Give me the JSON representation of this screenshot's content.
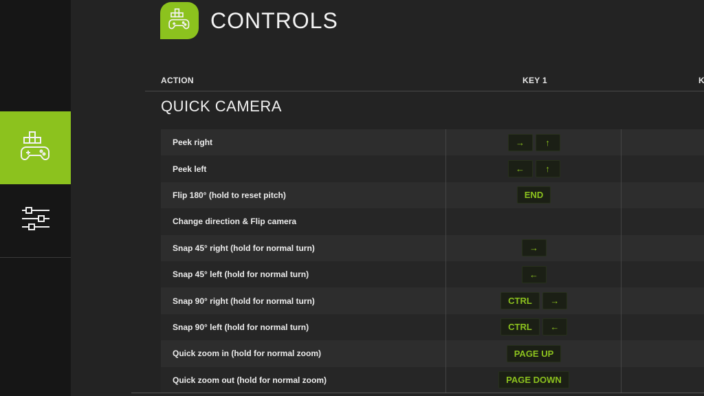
{
  "sidebar": {
    "tabs": [
      {
        "icon": "controls-icon",
        "active": true
      },
      {
        "icon": "sliders-icon",
        "active": false
      }
    ],
    "accent": "#8cc21e"
  },
  "header": {
    "title": "CONTROLS",
    "icon": "controls-icon"
  },
  "table": {
    "columns": {
      "action": "ACTION",
      "key1": "KEY 1",
      "key2": "K"
    },
    "section": "QUICK CAMERA",
    "rows": [
      {
        "label": "Peek right",
        "keys": [
          "→",
          "↑"
        ]
      },
      {
        "label": "Peek left",
        "keys": [
          "←",
          "↑"
        ]
      },
      {
        "label": "Flip 180° (hold to reset pitch)",
        "keys": [
          "END"
        ]
      },
      {
        "label": "Change direction & Flip camera",
        "keys": []
      },
      {
        "label": "Snap 45° right (hold for normal turn)",
        "keys": [
          "→"
        ]
      },
      {
        "label": "Snap 45° left (hold for normal turn)",
        "keys": [
          "←"
        ]
      },
      {
        "label": "Snap 90° right (hold for normal turn)",
        "keys": [
          "CTRL",
          "→"
        ]
      },
      {
        "label": "Snap 90° left (hold for normal turn)",
        "keys": [
          "CTRL",
          "←"
        ]
      },
      {
        "label": "Quick zoom in (hold for normal zoom)",
        "keys": [
          "PAGE UP"
        ]
      },
      {
        "label": "Quick zoom out (hold for normal zoom)",
        "keys": [
          "PAGE DOWN"
        ]
      }
    ]
  },
  "colors": {
    "accent": "#8cc21e",
    "key_bg": "#1b1f15",
    "panel": "#232323"
  }
}
